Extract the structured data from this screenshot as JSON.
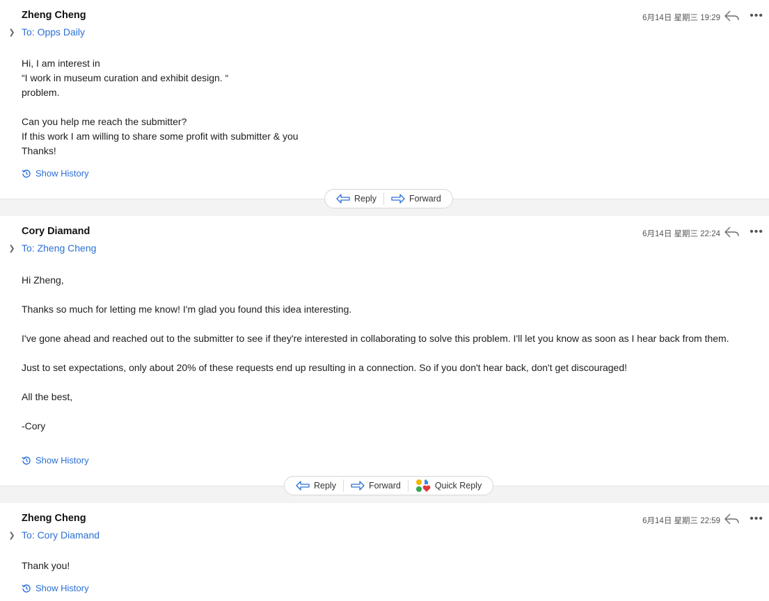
{
  "colors": {
    "link": "#2a6fd6",
    "divider_bg": "#f3f3f3"
  },
  "messages": [
    {
      "sender": "Zheng Cheng",
      "to": "To: Opps Daily",
      "date": "6月14日 星期三 19:29",
      "body": [
        "Hi, I am interest in",
        "“I work in museum curation and exhibit design. “",
        "problem.",
        "",
        "Can you help me reach the submitter?",
        "If this work I am willing to share some profit with submitter & you",
        "Thanks!"
      ],
      "history": "Show History"
    },
    {
      "sender": "Cory Diamand",
      "to": "To: Zheng Cheng",
      "date": "6月14日 星期三 22:24",
      "body": [
        "Hi Zheng,",
        "",
        "Thanks so much for letting me know! I'm glad you found this idea interesting.",
        "",
        "I've gone ahead and reached out to the submitter to see if they're interested in collaborating to solve this problem. I'll let you know as soon as I hear back from them.",
        "",
        "Just to set expectations, only about 20% of these requests end up resulting in a connection. So if you don't hear back, don't get discouraged!",
        "",
        "All the best,",
        "",
        "-Cory"
      ],
      "history": "Show History"
    },
    {
      "sender": "Zheng Cheng",
      "to": "To: Cory Diamand",
      "date": "6月14日 星期三 22:59",
      "body": [
        "Thank you!"
      ],
      "history": "Show History"
    }
  ],
  "actions": {
    "reply": "Reply",
    "forward": "Forward",
    "quick_reply": "Quick Reply"
  },
  "icons": {
    "reply": "reply-arrow-icon",
    "more": "more-dots-icon",
    "expand": "chevron-right-icon",
    "history": "history-clock-icon",
    "forward": "forward-arrow-icon",
    "quick_reply": "quick-reply-emoji-icon"
  }
}
